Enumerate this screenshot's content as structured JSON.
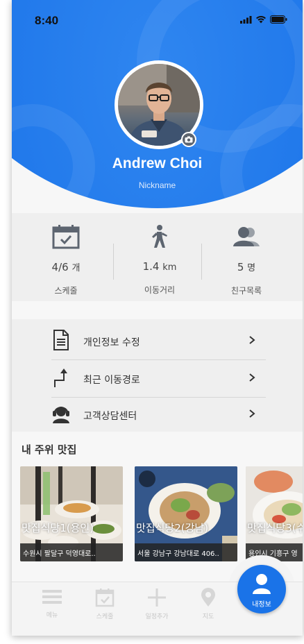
{
  "status_bar": {
    "time": "8:40"
  },
  "profile": {
    "name": "Andrew Choi",
    "nickname": "Nickname"
  },
  "stats": [
    {
      "value": "4/6",
      "unit": "개",
      "label": "스케줄",
      "icon": "calendar-check-icon"
    },
    {
      "value": "1.4",
      "unit": "km",
      "label": "이동거리",
      "icon": "walking-person-icon"
    },
    {
      "value": "5",
      "unit": "명",
      "label": "친구목록",
      "icon": "friends-icon"
    }
  ],
  "menu": [
    {
      "label": "개인정보 수정",
      "icon": "document-icon"
    },
    {
      "label": "최근 이동경로",
      "icon": "route-arrow-icon"
    },
    {
      "label": "고객상담센터",
      "icon": "headset-support-icon"
    }
  ],
  "restaurants_section": {
    "title": "내 주위 맛집",
    "cards": [
      {
        "title": "맛집식당1(용인)",
        "address": "수원시 팔달구 덕영대로.."
      },
      {
        "title": "맛집식당2(강남)",
        "address": "서울 강남구 강남대로 406.."
      },
      {
        "title": "맛집식당3(수",
        "address": "용인시 기흥구 영"
      }
    ]
  },
  "tabbar": {
    "tabs": [
      {
        "label": "메뉴",
        "icon": "hamburger-menu-icon"
      },
      {
        "label": "스케줄",
        "icon": "calendar-icon"
      },
      {
        "label": "일정추가",
        "icon": "plus-icon"
      },
      {
        "label": "지도",
        "icon": "map-pin-icon"
      }
    ],
    "active": {
      "label": "내정보",
      "icon": "user-icon"
    }
  },
  "colors": {
    "primary": "#1a73e8",
    "hero": "#1f77ea"
  }
}
